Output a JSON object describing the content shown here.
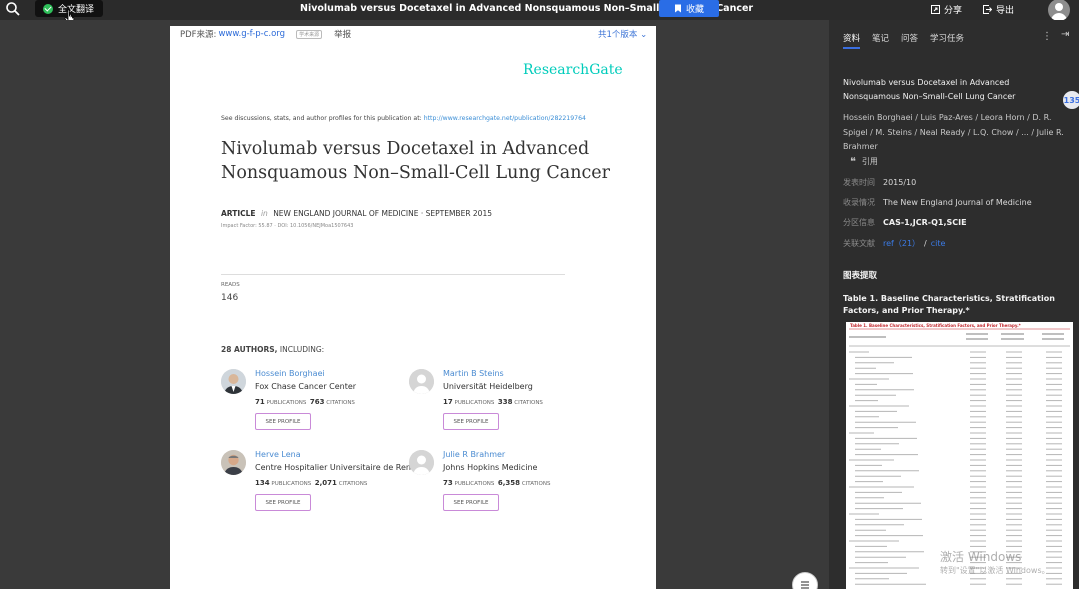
{
  "topbar": {
    "translate_label": "全文翻译",
    "title": "Nivolumab versus Docetaxel in Advanced Nonsquamous Non–Small-Cell Lung Cancer",
    "favorite_label": "收藏",
    "share_label": "分享",
    "export_label": "导出"
  },
  "page": {
    "source_label": "PDF来源:",
    "source_link": "www.g-f-p-c.org",
    "source_tag": "学术来源",
    "report_label": "举报",
    "versions_label": "共1个版本",
    "rg_logo": "ResearchGate",
    "discussion_text": "See discussions, stats, and author profiles for this publication at:",
    "discussion_url": "http://www.researchgate.net/publication/282219764",
    "paper_title": "Nivolumab versus Docetaxel in Advanced Nonsquamous Non–Small-Cell Lung Cancer",
    "article_label": "ARTICLE",
    "in_label": "in",
    "journal_line": "NEW ENGLAND JOURNAL OF MEDICINE · SEPTEMBER 2015",
    "impact_line": "Impact Factor: 55.87 · DOI: 10.1056/NEJMoa1507643",
    "reads_label": "READS",
    "reads_value": "146",
    "authors_count": "28 AUTHORS,",
    "authors_including": "INCLUDING:",
    "publications_label": "PUBLICATIONS",
    "citations_label": "CITATIONS",
    "see_profile_label": "SEE PROFILE",
    "authors": [
      {
        "name": "Hossein Borghaei",
        "inst": "Fox Chase Cancer Center",
        "pubs": "71",
        "cites": "763"
      },
      {
        "name": "Martin B Steins",
        "inst": "Universität Heidelberg",
        "pubs": "17",
        "cites": "338"
      },
      {
        "name": "Herve Lena",
        "inst": "Centre Hospitalier Universitaire de Rennes",
        "pubs": "134",
        "cites": "2,071"
      },
      {
        "name": "Julie R Brahmer",
        "inst": "Johns Hopkins Medicine",
        "pubs": "73",
        "cites": "6,358"
      }
    ]
  },
  "panel": {
    "tabs": [
      {
        "label": "资料"
      },
      {
        "label": "笔记"
      },
      {
        "label": "问答"
      },
      {
        "label": "学习任务"
      }
    ],
    "title": "Nivolumab versus Docetaxel in Advanced Nonsquamous Non–Small-Cell Lung Cancer",
    "authors": "Hossein Borghaei / Luis Paz-Ares / Leora Horn / D. R. Spigel / M. Steins / Neal Ready / L.Q. Chow / ... / Julie R. Brahmer",
    "badge": "135",
    "cite_label": "引用",
    "published_label": "发表时间",
    "published_value": "2015/10",
    "indexed_label": "收录情况",
    "indexed_value": "The New England Journal of Medicine",
    "partition_label": "分区信息",
    "partition_value": "CAS-1,JCR-Q1,SCIE",
    "related_label": "关联文献",
    "ref_label": "ref（21）",
    "slash": "/",
    "cite_link": "cite",
    "chart_extract_label": "图表提取",
    "table_title": "Table 1. Baseline Characteristics, Stratification Factors, and Prior Therapy.*",
    "thumb_head": "Table 1. Baseline Characteristics, Stratification Factors, and Prior Therapy.*",
    "watermark_line1": "激活 Windows",
    "watermark_line2": "转到\"设置\"以激活 Windows。"
  },
  "colors": {
    "accent": "#2a6de6",
    "rg_teal": "#00ccbb",
    "link": "#4a8bd1"
  }
}
